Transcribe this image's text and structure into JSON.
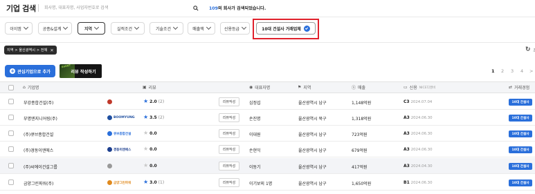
{
  "header": {
    "title": "기업 검색",
    "search_placeholder": "회사명, 대표자명, 사업자번호로 검색",
    "result_count": "109",
    "result_suffix": "의 회사가 검색되었습니다."
  },
  "filters": [
    {
      "label": "이이엠"
    },
    {
      "label": "공종&설계"
    },
    {
      "label": "지역"
    },
    {
      "label": "실적조건"
    },
    {
      "label": "기술조건"
    },
    {
      "label": "매출액"
    },
    {
      "label": "신용등급"
    }
  ],
  "top10_filter": {
    "label": "10대 건설사 거래업체"
  },
  "active_tag": {
    "label": "지역 > 울산광역시 > 전체",
    "close": "✕"
  },
  "refresh": {
    "icon": "↻",
    "label": "초"
  },
  "actions": {
    "add_label": "관심기업으로 추가",
    "add_icon": "+",
    "review_event": "EVENT",
    "review_label": "리뷰 작성하기"
  },
  "pagination": [
    "1",
    "2",
    "3",
    "4",
    ">"
  ],
  "columns": {
    "company": "기업명",
    "review": "리뷰",
    "ceo": "대표자명",
    "region": "지역",
    "sales": "매출",
    "credit": "신용",
    "credit_sub": "NICE디앤비",
    "trade": "거래경험"
  },
  "rows": [
    {
      "name": "부강종합건설(주)",
      "logo": "",
      "logo_color": "#c0392b",
      "star": "on",
      "rating": "2.0",
      "count": "(2)",
      "review_btn": "리뷰작성",
      "ceo": "심정섭",
      "region": "울산광역시 남구",
      "sales": "1,148억원",
      "grade": "C3",
      "date": "2024.07.04",
      "badge": "10대 건설사"
    },
    {
      "name": "부명엔지니어링(주)",
      "logo": "BOOMYUNG",
      "logo_color": "#1f4fa0",
      "star": "on",
      "rating": "3.5",
      "count": "(2)",
      "review_btn": "리뷰작성",
      "ceo": "손진명",
      "region": "울산광역시 북구",
      "sales": "1,318억원",
      "grade": "A3",
      "date": "2024.06.30",
      "badge": "10대 건설사"
    },
    {
      "name": "(주)큐브종합건설",
      "logo": "큐브종합건설",
      "logo_color": "#2a6fdb",
      "star": "off",
      "rating": "0.0",
      "count": "",
      "review_btn": "리뷰작성",
      "ceo": "이대원",
      "region": "울산광역시 남구",
      "sales": "723억원",
      "grade": "A3",
      "date": "2024.06.30",
      "badge": "10대 건설사"
    },
    {
      "name": "(주)경동이엔에스",
      "logo": "경동이엔에스",
      "logo_color": "#1d3f8f",
      "star": "off",
      "rating": "0.0",
      "count": "",
      "review_btn": "리뷰작성",
      "ceo": "손현익",
      "region": "울산광역시 남구",
      "sales": "679억원",
      "grade": "A3",
      "date": "2024.06.30",
      "badge": "10대 건설사"
    },
    {
      "name": "(주)씨에이건설그룹",
      "logo": "",
      "logo_color": "#999999",
      "star": "off",
      "rating": "0.0",
      "count": "",
      "review_btn": "리뷰작성",
      "ceo": "이동기",
      "region": "울산광역시 남구",
      "sales": "417억원",
      "grade": "A3",
      "date": "2024.04.30",
      "badge": "10대 건설사"
    },
    {
      "name": "금양그린파워(주)",
      "logo": "금양그린파워",
      "logo_color": "#e08a1e",
      "star": "on",
      "rating": "3.0",
      "count": "(1)",
      "review_btn": "리뷰작성",
      "ceo": "이기보외 1명",
      "region": "울산광역시 남구",
      "sales": "1,650억원",
      "grade": "B1",
      "date": "2024.06.30",
      "badge": "10대 건설사"
    }
  ],
  "colors": {
    "accent": "#2a6fdb",
    "highlight": "#e0202b"
  }
}
